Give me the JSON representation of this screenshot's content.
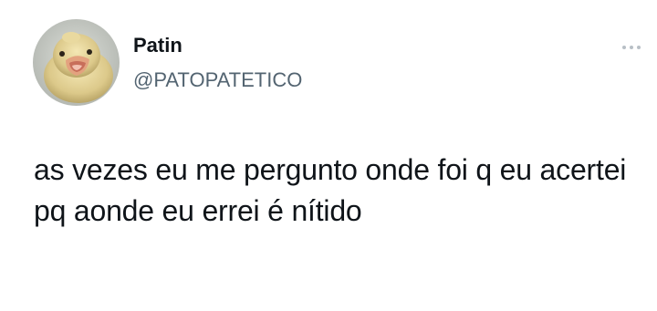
{
  "tweet": {
    "author": {
      "display_name": "Patin",
      "handle": "@PATOPATETICO",
      "avatar_icon": "duckling-avatar"
    },
    "more_icon": "ellipsis-icon",
    "text": "as vezes eu me pergunto onde foi q eu acertei\npq aonde eu errei é nítido"
  },
  "colors": {
    "background": "#ffffff",
    "text_primary": "#0f1419",
    "text_secondary": "#536471",
    "avatar_bg": "#c9ccc7"
  }
}
